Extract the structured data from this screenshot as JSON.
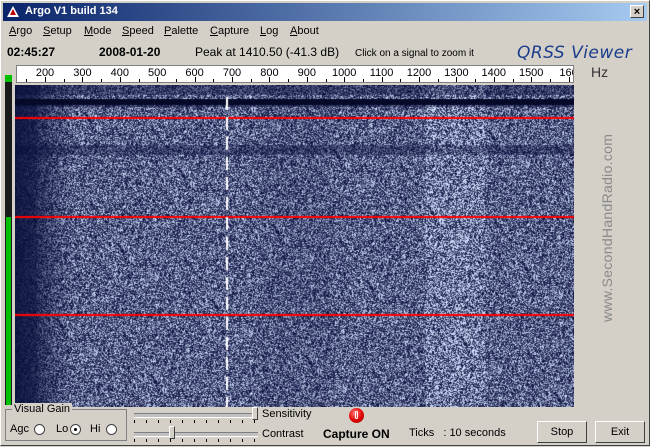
{
  "window": {
    "title": "Argo V1 build 134",
    "close_label": "×"
  },
  "menu": [
    {
      "label": "Argo",
      "u": "A",
      "rest": "rgo"
    },
    {
      "label": "Setup",
      "u": "S",
      "rest": "etup"
    },
    {
      "label": "Mode",
      "u": "M",
      "rest": "ode"
    },
    {
      "label": "Speed",
      "u": "S",
      "rest": "peed"
    },
    {
      "label": "Palette",
      "u": "P",
      "rest": "alette"
    },
    {
      "label": "Capture",
      "u": "C",
      "rest": "apture"
    },
    {
      "label": "Log",
      "u": "L",
      "rest": "og"
    },
    {
      "label": "About",
      "u": "A",
      "rest": "bout"
    }
  ],
  "status": {
    "time": "02:45:27",
    "date": "2008-01-20",
    "peak": "Peak at 1410.50 (-41.3 dB)",
    "hint": "Click on a signal to zoom it",
    "brand": "QRSS Viewer",
    "unit": "Hz"
  },
  "ruler": {
    "labels": [
      "200",
      "300",
      "400",
      "500",
      "600",
      "700",
      "800",
      "900",
      "1000",
      "1100",
      "1200",
      "1300",
      "1400",
      "1500",
      "160"
    ]
  },
  "watermark": "www.SecondHandRadio.com",
  "level": {
    "fraction": 0.57
  },
  "colors": {
    "spectrum_bg": "#0a0f40",
    "marker_line": "#ff0000",
    "cursor_line": "#ffffff",
    "level_green": "#00c000"
  },
  "controls": {
    "visual_gain_label": "Visual Gain",
    "agc_label": "Agc",
    "lo_label": "Lo",
    "hi_label": "Hi",
    "selected_gain": "lo",
    "sensitivity_label": "Sensitivity",
    "sensitivity_value": 1.0,
    "contrast_label": "Contrast",
    "contrast_value": 0.3,
    "capture_label": "Capture ON",
    "ticks_label": "Ticks",
    "ticks_value": ": 10 seconds",
    "stop_label": "Stop",
    "exit_label": "Exit"
  }
}
